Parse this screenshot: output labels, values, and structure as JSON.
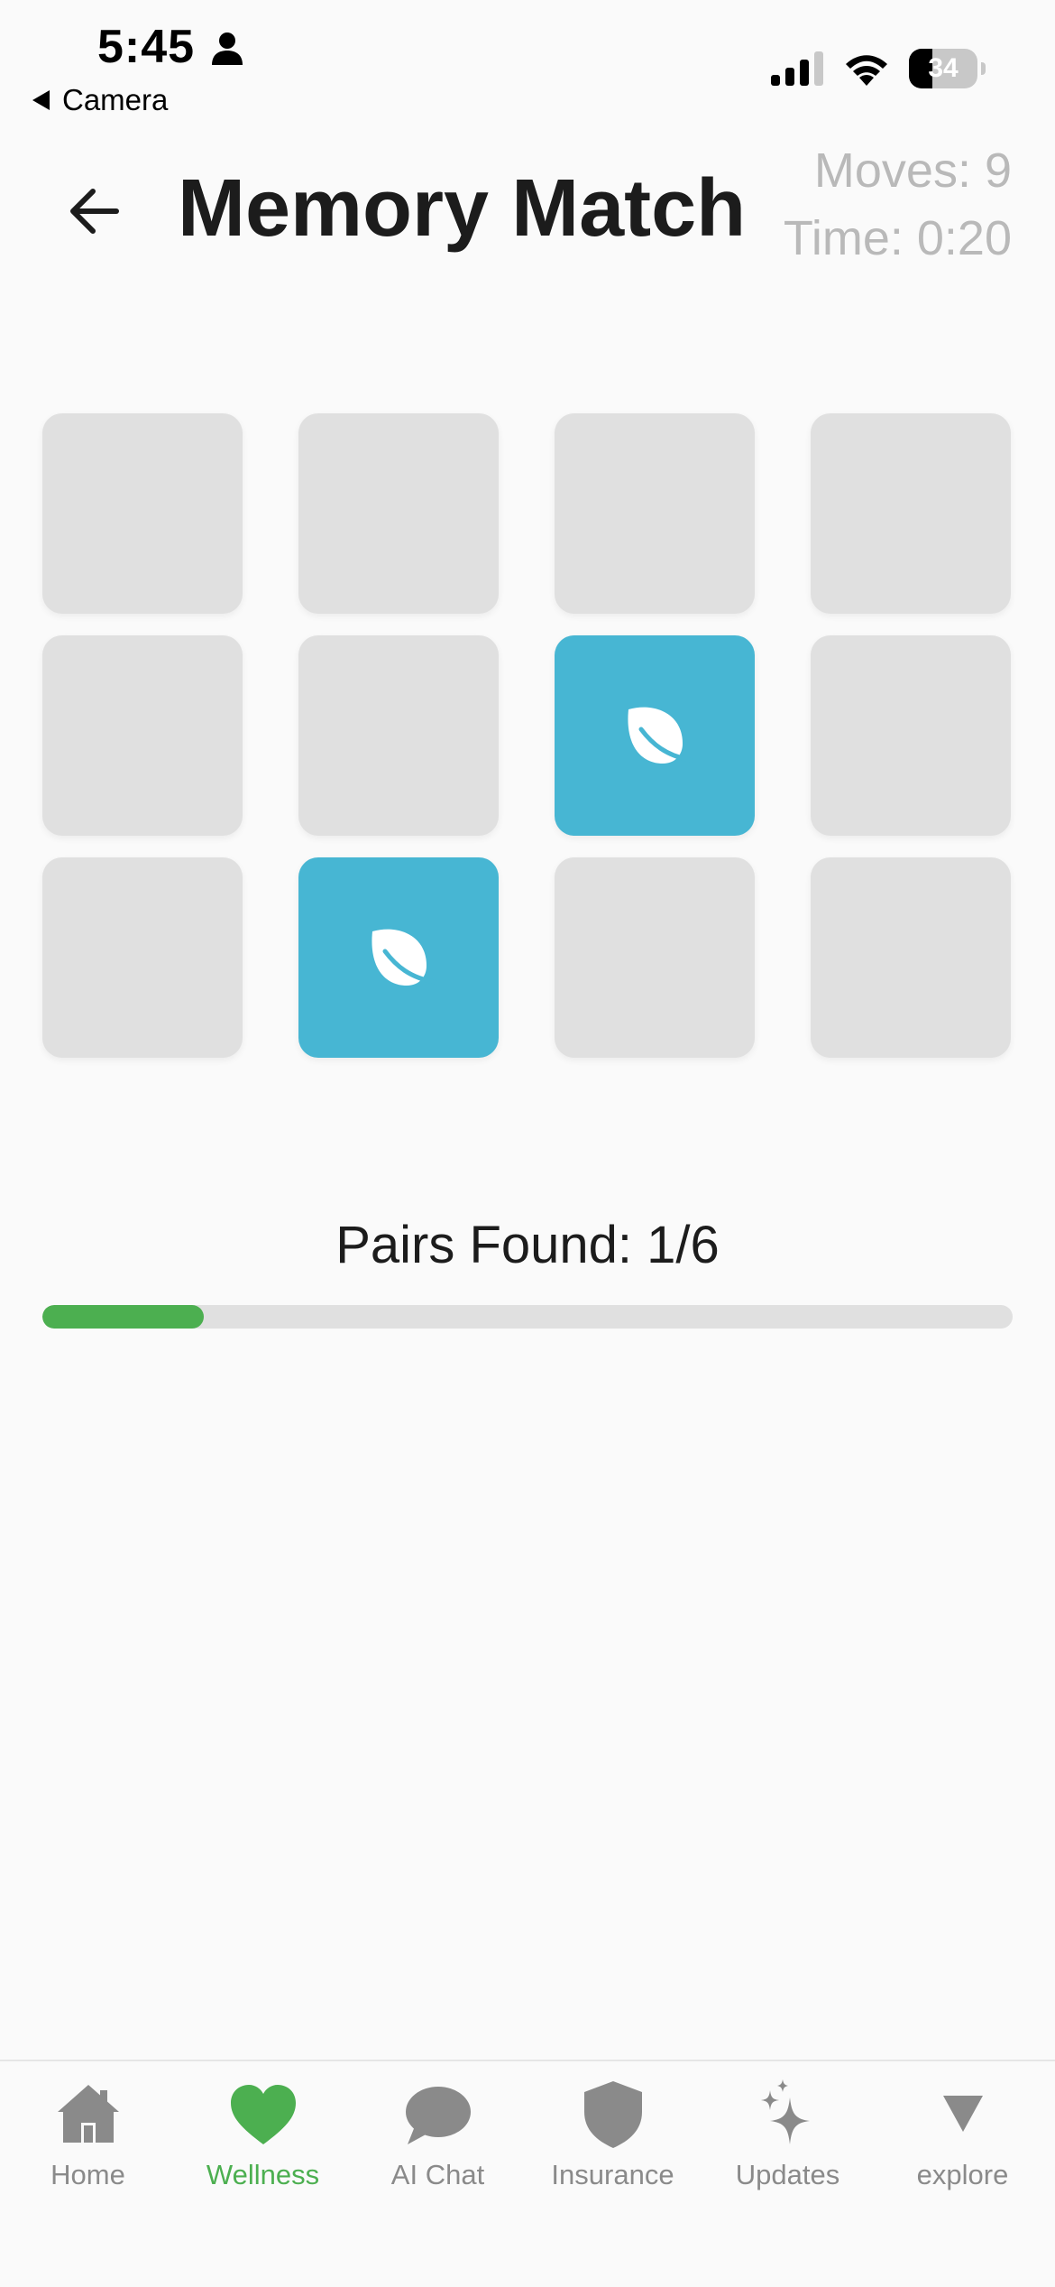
{
  "status_bar": {
    "time": "5:45",
    "back_app": "Camera",
    "battery": "34",
    "battery_level": 0.34
  },
  "header": {
    "title": "Memory Match",
    "moves": "Moves: 9",
    "time": "Time: 0:20"
  },
  "grid": {
    "columns": 4,
    "rows": 3,
    "cards": [
      {
        "state": "hidden",
        "icon": ""
      },
      {
        "state": "hidden",
        "icon": ""
      },
      {
        "state": "hidden",
        "icon": ""
      },
      {
        "state": "hidden",
        "icon": ""
      },
      {
        "state": "hidden",
        "icon": ""
      },
      {
        "state": "hidden",
        "icon": ""
      },
      {
        "state": "flipped",
        "icon": "leaf-icon"
      },
      {
        "state": "hidden",
        "icon": ""
      },
      {
        "state": "hidden",
        "icon": ""
      },
      {
        "state": "flipped",
        "icon": "leaf-icon"
      },
      {
        "state": "hidden",
        "icon": ""
      },
      {
        "state": "hidden",
        "icon": ""
      }
    ]
  },
  "progress": {
    "label": "Pairs Found: 1/6",
    "found": 1,
    "total": 6,
    "fraction": 0.1667
  },
  "tab_bar": {
    "tabs": [
      {
        "label": "Home",
        "icon": "home-icon",
        "active": false
      },
      {
        "label": "Wellness",
        "icon": "heart-icon",
        "active": true
      },
      {
        "label": "AI Chat",
        "icon": "chat-bubble-icon",
        "active": false
      },
      {
        "label": "Insurance",
        "icon": "shield-icon",
        "active": false
      },
      {
        "label": "Updates",
        "icon": "sparkles-icon",
        "active": false
      },
      {
        "label": "explore",
        "icon": "triangle-down-icon",
        "active": false
      }
    ]
  },
  "colors": {
    "accent": "#4caf50",
    "card_flipped": "#47b6d3",
    "card_hidden": "#e0e0e0",
    "muted_text": "#b9b9b9",
    "tab_inactive": "#8a8a8a",
    "background": "#fafafa"
  }
}
